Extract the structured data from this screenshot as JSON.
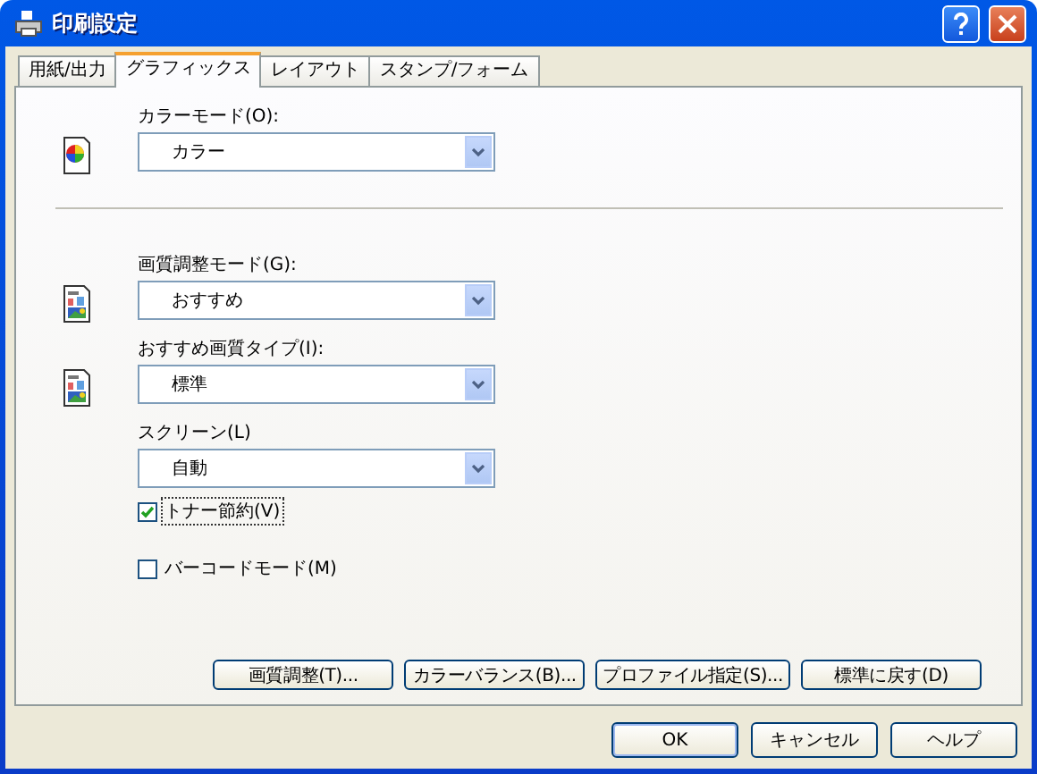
{
  "window": {
    "title": "印刷設定"
  },
  "tabs": [
    {
      "label": "用紙/出力",
      "selected": false
    },
    {
      "label": "グラフィックス",
      "selected": true
    },
    {
      "label": "レイアウト",
      "selected": false
    },
    {
      "label": "スタンプ/フォーム",
      "selected": false
    }
  ],
  "sections": [
    {
      "fields": [
        {
          "kind": "color",
          "label": "カラーモード(O):",
          "value": "カラー"
        }
      ]
    },
    {
      "fields": [
        {
          "kind": "image",
          "label": "画質調整モード(G):",
          "value": "おすすめ"
        },
        {
          "kind": "image",
          "label": "おすすめ画質タイプ(I):",
          "value": "標準"
        },
        {
          "kind": "plain",
          "label": "スクリーン(L)",
          "value": "自動"
        }
      ]
    }
  ],
  "checkboxes": [
    {
      "label": "トナー節約(V)",
      "checked": true,
      "focused": true
    },
    {
      "label": "バーコードモード(M)",
      "checked": false,
      "focused": false
    }
  ],
  "panel_buttons": [
    "画質調整(T)...",
    "カラーバランス(B)...",
    "プロファイル指定(S)...",
    "標準に戻す(D)"
  ],
  "dialog_buttons": [
    {
      "label": "OK",
      "default": true
    },
    {
      "label": "キャンセル",
      "default": false
    },
    {
      "label": "ヘルプ",
      "default": false
    }
  ]
}
